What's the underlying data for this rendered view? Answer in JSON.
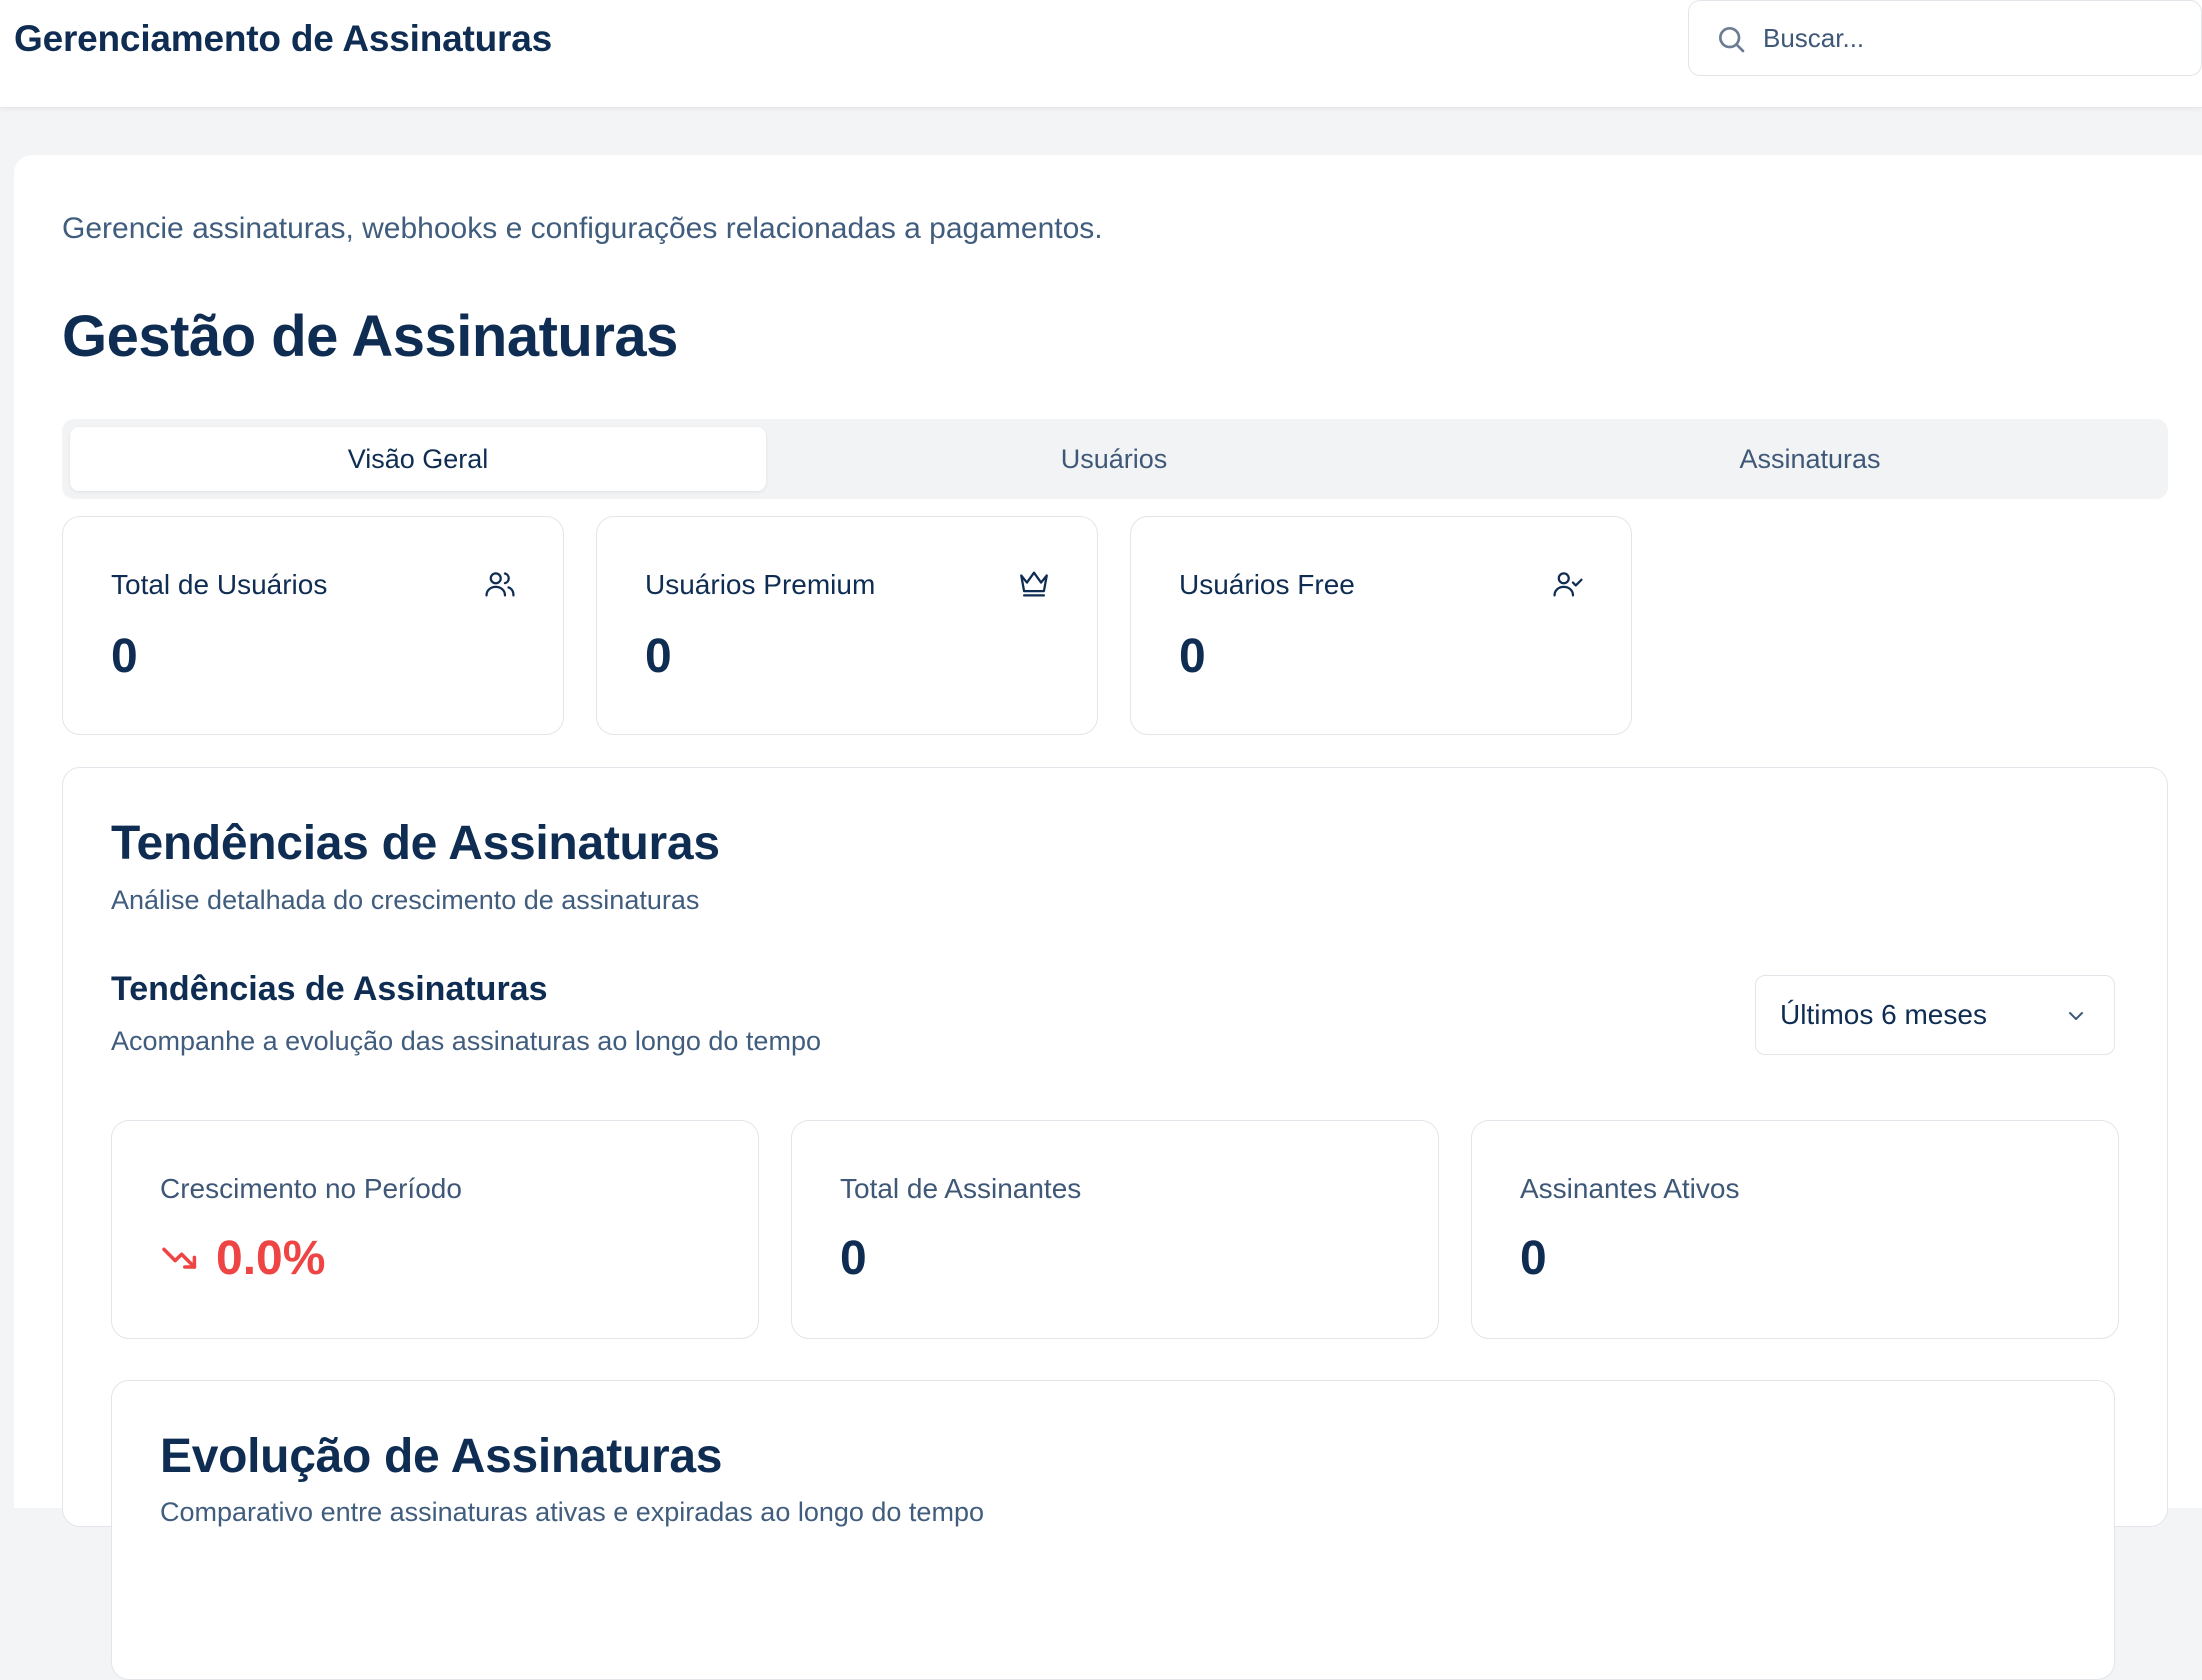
{
  "header": {
    "app_title": "Gerenciamento de Assinaturas",
    "search": {
      "placeholder": "Buscar..."
    }
  },
  "page": {
    "description": "Gerencie assinaturas, webhooks e configurações relacionadas a pagamentos.",
    "title": "Gestão de Assinaturas"
  },
  "tabs": [
    {
      "label": "Visão Geral",
      "active": true
    },
    {
      "label": "Usuários",
      "active": false
    },
    {
      "label": "Assinaturas",
      "active": false
    }
  ],
  "stats": [
    {
      "label": "Total de Usuários",
      "value": "0",
      "icon": "users-icon"
    },
    {
      "label": "Usuários Premium",
      "value": "0",
      "icon": "crown-icon"
    },
    {
      "label": "Usuários Free",
      "value": "0",
      "icon": "user-check-icon"
    }
  ],
  "trends": {
    "title": "Tendências de Assinaturas",
    "subtitle": "Análise detalhada do crescimento de assinaturas",
    "section_title": "Tendências de Assinaturas",
    "section_subtitle": "Acompanhe a evolução das assinaturas ao longo do tempo",
    "period_select": {
      "value": "Últimos 6 meses"
    },
    "metrics": [
      {
        "label": "Crescimento no Período",
        "value": "0.0%",
        "icon": "trending-down-icon"
      },
      {
        "label": "Total de Assinantes",
        "value": "0"
      },
      {
        "label": "Assinantes Ativos",
        "value": "0"
      }
    ],
    "evolution": {
      "title": "Evolução de Assinaturas",
      "subtitle": "Comparativo entre assinaturas ativas e expiradas ao longo do tempo"
    }
  },
  "colors": {
    "primary_text": "#0f2d52",
    "muted_text": "#415d7e",
    "negative": "#ef4444",
    "border": "#e2e5ea",
    "page_bg": "#f3f4f6"
  }
}
